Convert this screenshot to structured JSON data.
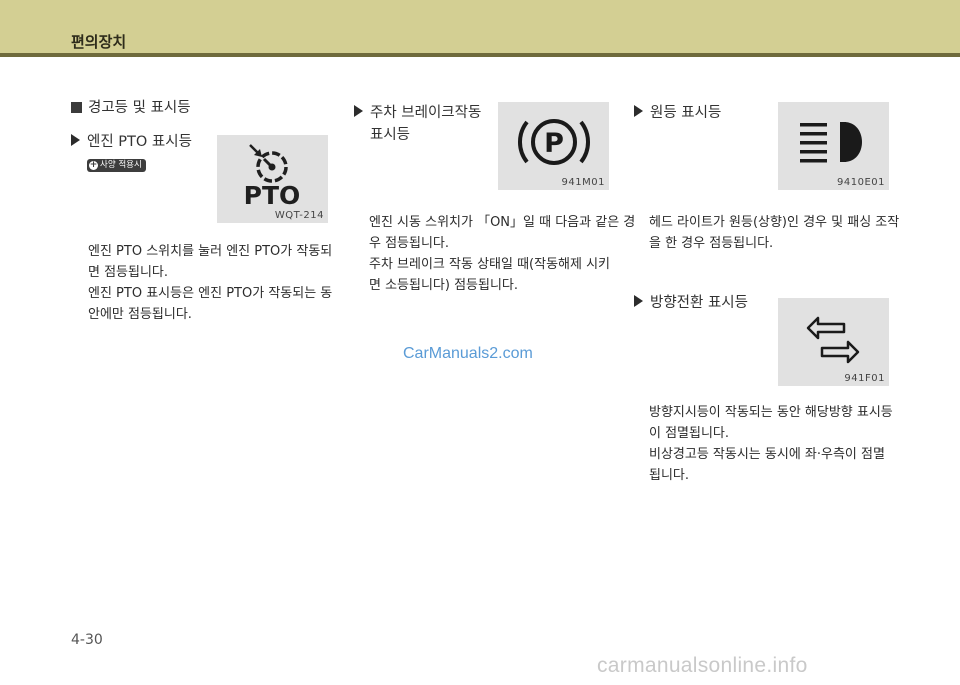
{
  "header": {
    "title": "편의장치"
  },
  "section_main": {
    "title": "경고등 및 표시등"
  },
  "pto": {
    "title": "엔진 PTO 표시등",
    "badge": "사양 적용시",
    "icon_text": "PTO",
    "fig_code": "WQT-214",
    "body": [
      "엔진 PTO 스위치를 눌러 엔진 PTO가 작동되",
      "면 점등됩니다.",
      "엔진 PTO 표시등은 엔진 PTO가 작동되는 동",
      "안에만 점등됩니다."
    ]
  },
  "parking": {
    "title_lines": [
      "주차 브레이크작동",
      "표시등"
    ],
    "icon_text": "P",
    "fig_code": "941M01",
    "body": [
      "엔진 시동 스위치가 「ON」일 때 다음과 같은 경",
      "우 점등됩니다.",
      "주차 브레이크 작동 상태일 때(작동해제 시키",
      "면 소등됩니다) 점등됩니다."
    ]
  },
  "highbeam": {
    "title": "원등 표시등",
    "fig_code": "9410E01",
    "body": [
      "헤드 라이트가 원등(상향)인 경우 및 패싱 조작",
      "을 한 경우 점등됩니다."
    ]
  },
  "turn": {
    "title": "방향전환 표시등",
    "fig_code": "941F01",
    "body": [
      "방향지시등이 작동되는 동안 해당방향 표시등",
      "이 점멸됩니다.",
      "비상경고등 작동시는 동시에 좌·우측이 점멸",
      "됩니다."
    ]
  },
  "watermark": "CarManuals2.com",
  "page_number": "4-30",
  "footer_watermark": "carmanualsonline.info",
  "colors": {
    "header_bg": "#d3cf93",
    "header_rule": "#6f6b3c",
    "figure_bg": "#e1e1e1",
    "watermark": "#5a9bd6"
  }
}
